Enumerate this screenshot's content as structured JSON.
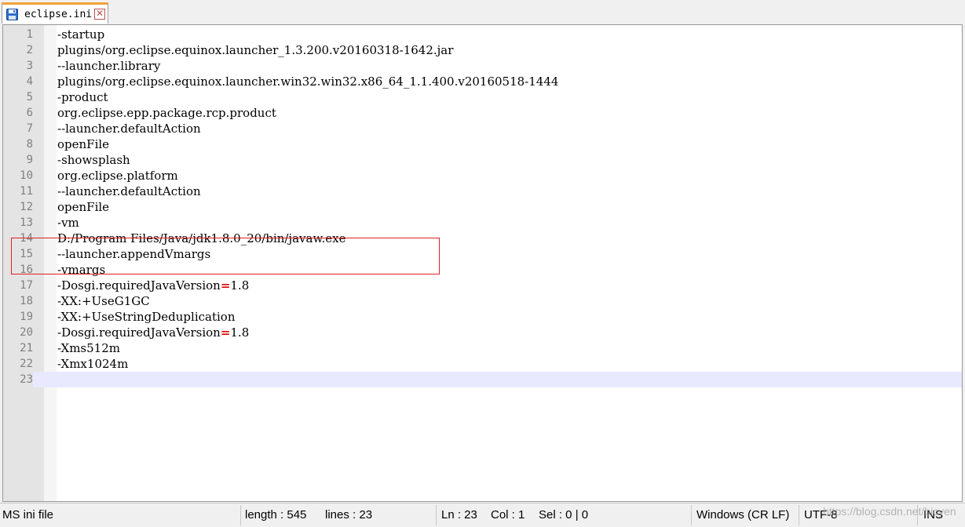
{
  "tab": {
    "title": "eclipse.ini",
    "close_glyph": "✕"
  },
  "editor": {
    "lines": [
      "-startup",
      "plugins/org.eclipse.equinox.launcher_1.3.200.v20160318-1642.jar",
      "--launcher.library",
      "plugins/org.eclipse.equinox.launcher.win32.win32.x86_64_1.1.400.v20160518-1444",
      "-product",
      "org.eclipse.epp.package.rcp.product",
      "--launcher.defaultAction",
      "openFile",
      "-showsplash",
      "org.eclipse.platform",
      "--launcher.defaultAction",
      "openFile",
      "-vm",
      "D:/Program Files/Java/jdk1.8.0_20/bin/javaw.exe",
      "--launcher.appendVmargs",
      "-vmargs",
      "-Dosgi.requiredJavaVersion=1.8",
      "-XX:+UseG1GC",
      "-XX:+UseStringDeduplication",
      "-Dosgi.requiredJavaVersion=1.8",
      "-Xms512m",
      "-Xmx1024m",
      ""
    ],
    "current_line": 23,
    "highlighted_lines": [
      13,
      14
    ]
  },
  "status": {
    "file_type": "MS ini file",
    "length": "length : 545",
    "lines": "lines : 23",
    "ln": "Ln : 23",
    "col": "Col : 1",
    "sel": "Sel : 0 | 0",
    "eol": "Windows (CR LF)",
    "encoding": "UTF-8",
    "mode": "INS"
  },
  "watermark": "https://blog.csdn.net/bicyen",
  "colors": {
    "tab_accent": "#f3a23a",
    "highlight_box": "#e02020",
    "operator": "#e00000",
    "current_line": "#e8e8ff"
  },
  "icons": {
    "tab": "save-disk-icon",
    "close": "close-icon"
  }
}
